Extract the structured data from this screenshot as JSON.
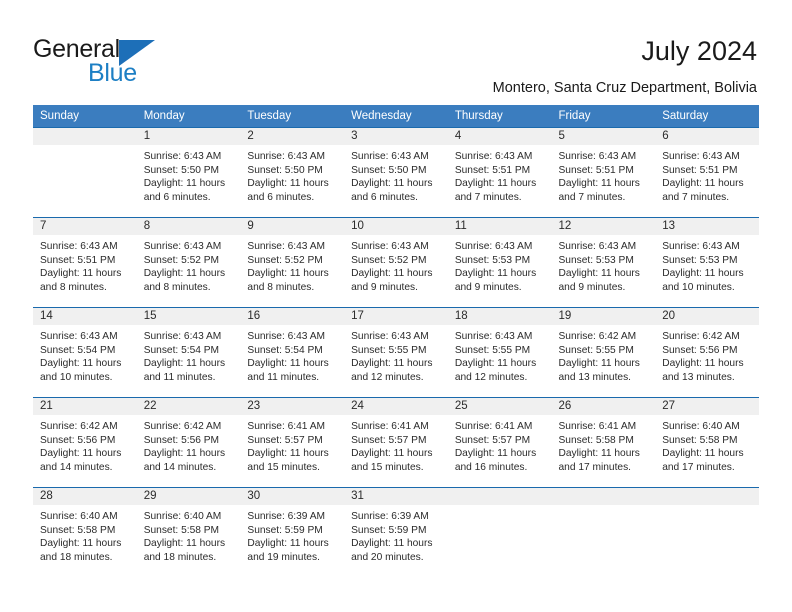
{
  "brand": {
    "name_part1": "General",
    "name_part2": "Blue",
    "triangle_icon": "brand-triangle-icon",
    "accent_dark": "#1d6fb8",
    "accent_light": "#1d7fc4"
  },
  "header": {
    "title": "July 2024",
    "subtitle": "Montero, Santa Cruz Department, Bolivia"
  },
  "theme": {
    "header_bar": "#3b7dbf",
    "row_divider": "#1a6aad",
    "daynum_band": "#f0f0f0",
    "page_background": "#ffffff",
    "text": "#2b2b2b"
  },
  "calendar": {
    "weekday_headers": [
      "Sunday",
      "Monday",
      "Tuesday",
      "Wednesday",
      "Thursday",
      "Friday",
      "Saturday"
    ],
    "weeks": [
      [
        {
          "day": "",
          "blank": true,
          "sunrise": "",
          "sunset": "",
          "daylight_line1": "",
          "daylight_line2": ""
        },
        {
          "day": "1",
          "sunrise": "Sunrise: 6:43 AM",
          "sunset": "Sunset: 5:50 PM",
          "daylight_line1": "Daylight: 11 hours",
          "daylight_line2": "and 6 minutes."
        },
        {
          "day": "2",
          "sunrise": "Sunrise: 6:43 AM",
          "sunset": "Sunset: 5:50 PM",
          "daylight_line1": "Daylight: 11 hours",
          "daylight_line2": "and 6 minutes."
        },
        {
          "day": "3",
          "sunrise": "Sunrise: 6:43 AM",
          "sunset": "Sunset: 5:50 PM",
          "daylight_line1": "Daylight: 11 hours",
          "daylight_line2": "and 6 minutes."
        },
        {
          "day": "4",
          "sunrise": "Sunrise: 6:43 AM",
          "sunset": "Sunset: 5:51 PM",
          "daylight_line1": "Daylight: 11 hours",
          "daylight_line2": "and 7 minutes."
        },
        {
          "day": "5",
          "sunrise": "Sunrise: 6:43 AM",
          "sunset": "Sunset: 5:51 PM",
          "daylight_line1": "Daylight: 11 hours",
          "daylight_line2": "and 7 minutes."
        },
        {
          "day": "6",
          "sunrise": "Sunrise: 6:43 AM",
          "sunset": "Sunset: 5:51 PM",
          "daylight_line1": "Daylight: 11 hours",
          "daylight_line2": "and 7 minutes."
        }
      ],
      [
        {
          "day": "7",
          "sunrise": "Sunrise: 6:43 AM",
          "sunset": "Sunset: 5:51 PM",
          "daylight_line1": "Daylight: 11 hours",
          "daylight_line2": "and 8 minutes."
        },
        {
          "day": "8",
          "sunrise": "Sunrise: 6:43 AM",
          "sunset": "Sunset: 5:52 PM",
          "daylight_line1": "Daylight: 11 hours",
          "daylight_line2": "and 8 minutes."
        },
        {
          "day": "9",
          "sunrise": "Sunrise: 6:43 AM",
          "sunset": "Sunset: 5:52 PM",
          "daylight_line1": "Daylight: 11 hours",
          "daylight_line2": "and 8 minutes."
        },
        {
          "day": "10",
          "sunrise": "Sunrise: 6:43 AM",
          "sunset": "Sunset: 5:52 PM",
          "daylight_line1": "Daylight: 11 hours",
          "daylight_line2": "and 9 minutes."
        },
        {
          "day": "11",
          "sunrise": "Sunrise: 6:43 AM",
          "sunset": "Sunset: 5:53 PM",
          "daylight_line1": "Daylight: 11 hours",
          "daylight_line2": "and 9 minutes."
        },
        {
          "day": "12",
          "sunrise": "Sunrise: 6:43 AM",
          "sunset": "Sunset: 5:53 PM",
          "daylight_line1": "Daylight: 11 hours",
          "daylight_line2": "and 9 minutes."
        },
        {
          "day": "13",
          "sunrise": "Sunrise: 6:43 AM",
          "sunset": "Sunset: 5:53 PM",
          "daylight_line1": "Daylight: 11 hours",
          "daylight_line2": "and 10 minutes."
        }
      ],
      [
        {
          "day": "14",
          "sunrise": "Sunrise: 6:43 AM",
          "sunset": "Sunset: 5:54 PM",
          "daylight_line1": "Daylight: 11 hours",
          "daylight_line2": "and 10 minutes."
        },
        {
          "day": "15",
          "sunrise": "Sunrise: 6:43 AM",
          "sunset": "Sunset: 5:54 PM",
          "daylight_line1": "Daylight: 11 hours",
          "daylight_line2": "and 11 minutes."
        },
        {
          "day": "16",
          "sunrise": "Sunrise: 6:43 AM",
          "sunset": "Sunset: 5:54 PM",
          "daylight_line1": "Daylight: 11 hours",
          "daylight_line2": "and 11 minutes."
        },
        {
          "day": "17",
          "sunrise": "Sunrise: 6:43 AM",
          "sunset": "Sunset: 5:55 PM",
          "daylight_line1": "Daylight: 11 hours",
          "daylight_line2": "and 12 minutes."
        },
        {
          "day": "18",
          "sunrise": "Sunrise: 6:43 AM",
          "sunset": "Sunset: 5:55 PM",
          "daylight_line1": "Daylight: 11 hours",
          "daylight_line2": "and 12 minutes."
        },
        {
          "day": "19",
          "sunrise": "Sunrise: 6:42 AM",
          "sunset": "Sunset: 5:55 PM",
          "daylight_line1": "Daylight: 11 hours",
          "daylight_line2": "and 13 minutes."
        },
        {
          "day": "20",
          "sunrise": "Sunrise: 6:42 AM",
          "sunset": "Sunset: 5:56 PM",
          "daylight_line1": "Daylight: 11 hours",
          "daylight_line2": "and 13 minutes."
        }
      ],
      [
        {
          "day": "21",
          "sunrise": "Sunrise: 6:42 AM",
          "sunset": "Sunset: 5:56 PM",
          "daylight_line1": "Daylight: 11 hours",
          "daylight_line2": "and 14 minutes."
        },
        {
          "day": "22",
          "sunrise": "Sunrise: 6:42 AM",
          "sunset": "Sunset: 5:56 PM",
          "daylight_line1": "Daylight: 11 hours",
          "daylight_line2": "and 14 minutes."
        },
        {
          "day": "23",
          "sunrise": "Sunrise: 6:41 AM",
          "sunset": "Sunset: 5:57 PM",
          "daylight_line1": "Daylight: 11 hours",
          "daylight_line2": "and 15 minutes."
        },
        {
          "day": "24",
          "sunrise": "Sunrise: 6:41 AM",
          "sunset": "Sunset: 5:57 PM",
          "daylight_line1": "Daylight: 11 hours",
          "daylight_line2": "and 15 minutes."
        },
        {
          "day": "25",
          "sunrise": "Sunrise: 6:41 AM",
          "sunset": "Sunset: 5:57 PM",
          "daylight_line1": "Daylight: 11 hours",
          "daylight_line2": "and 16 minutes."
        },
        {
          "day": "26",
          "sunrise": "Sunrise: 6:41 AM",
          "sunset": "Sunset: 5:58 PM",
          "daylight_line1": "Daylight: 11 hours",
          "daylight_line2": "and 17 minutes."
        },
        {
          "day": "27",
          "sunrise": "Sunrise: 6:40 AM",
          "sunset": "Sunset: 5:58 PM",
          "daylight_line1": "Daylight: 11 hours",
          "daylight_line2": "and 17 minutes."
        }
      ],
      [
        {
          "day": "28",
          "sunrise": "Sunrise: 6:40 AM",
          "sunset": "Sunset: 5:58 PM",
          "daylight_line1": "Daylight: 11 hours",
          "daylight_line2": "and 18 minutes."
        },
        {
          "day": "29",
          "sunrise": "Sunrise: 6:40 AM",
          "sunset": "Sunset: 5:58 PM",
          "daylight_line1": "Daylight: 11 hours",
          "daylight_line2": "and 18 minutes."
        },
        {
          "day": "30",
          "sunrise": "Sunrise: 6:39 AM",
          "sunset": "Sunset: 5:59 PM",
          "daylight_line1": "Daylight: 11 hours",
          "daylight_line2": "and 19 minutes."
        },
        {
          "day": "31",
          "sunrise": "Sunrise: 6:39 AM",
          "sunset": "Sunset: 5:59 PM",
          "daylight_line1": "Daylight: 11 hours",
          "daylight_line2": "and 20 minutes."
        },
        {
          "day": "",
          "blank": true,
          "sunrise": "",
          "sunset": "",
          "daylight_line1": "",
          "daylight_line2": ""
        },
        {
          "day": "",
          "blank": true,
          "sunrise": "",
          "sunset": "",
          "daylight_line1": "",
          "daylight_line2": ""
        },
        {
          "day": "",
          "blank": true,
          "sunrise": "",
          "sunset": "",
          "daylight_line1": "",
          "daylight_line2": ""
        }
      ]
    ]
  }
}
